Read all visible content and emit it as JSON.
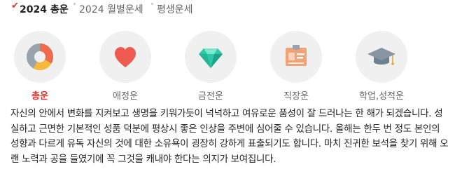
{
  "tabs": [
    {
      "label": "2024 총운",
      "active": true
    },
    {
      "label": "2024 월별운세",
      "active": false
    },
    {
      "label": "평생운세",
      "active": false
    }
  ],
  "categories": [
    {
      "label": "총운",
      "icon": "donut-chart-icon",
      "active": true
    },
    {
      "label": "애정운",
      "icon": "heart-icon",
      "active": false
    },
    {
      "label": "금전운",
      "icon": "gem-icon",
      "active": false
    },
    {
      "label": "직장운",
      "icon": "id-card-icon",
      "active": false
    },
    {
      "label": "학업,성적운",
      "icon": "graduation-cap-icon",
      "active": false
    }
  ],
  "description": "자신의 안에서 변화를 지켜보고 생명을 키워가듯이 넉넉하고 여유로운 품성이 잘 드러나는 한 해가 되겠습니다. 성실하고 근면한 기본적인 성품 덕분에 평상시 좋은 인상을 주변에 심어줄 수 있습니다. 올해는 한두 번 정도 본인의 성향과 다르게 유독 자신의 것에 대한 소유욕이 굉장히 강하게 표출되기도 합니다. 마치 진귀한 보석을 찾기 위해 오랜 노력과 공을 들였기에 꼭 그것을 캐내야 한다는 의지가 보여집니다.",
  "colors": {
    "accent": "#e5342c",
    "circle_bg": "#f0f0f0"
  }
}
